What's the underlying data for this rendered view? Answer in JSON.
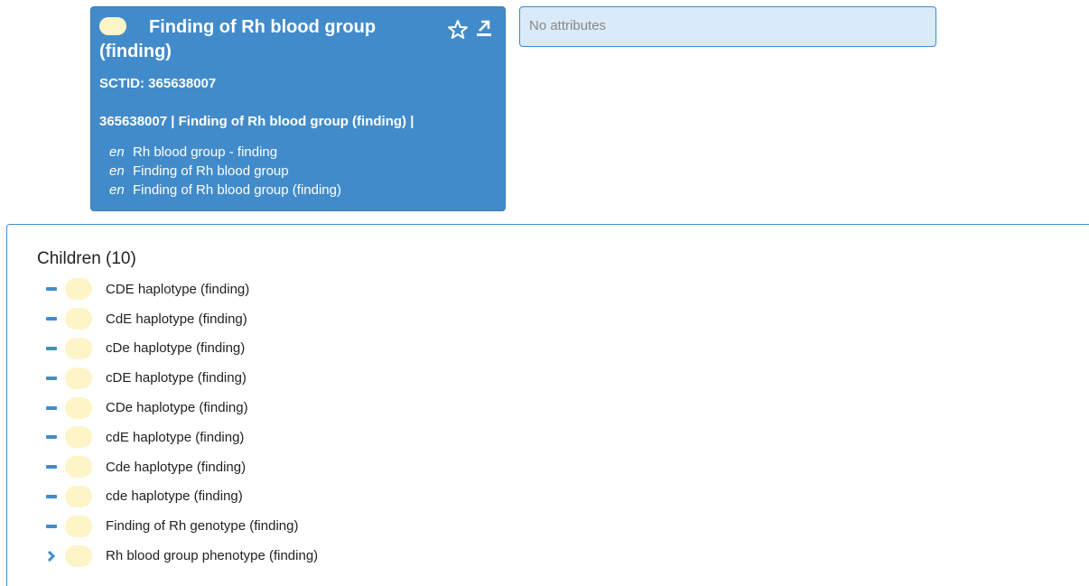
{
  "concept": {
    "title": "Finding of Rh blood group (finding)",
    "sctid_label": "SCTID: 365638007",
    "fsn_line": "365638007 | Finding of Rh blood group (finding) |",
    "descriptions": [
      {
        "lang": "en",
        "term": "Rh blood group - finding"
      },
      {
        "lang": "en",
        "term": "Finding of Rh blood group"
      },
      {
        "lang": "en",
        "term": "Finding of Rh blood group (finding)"
      }
    ],
    "icons": {
      "favorite": "star-outline-icon",
      "export": "export-icon"
    },
    "color": "#428bca",
    "badge_color": "#fdf4c8"
  },
  "attributes": {
    "text": "No attributes"
  },
  "children": {
    "heading": "Children (10)",
    "items": [
      {
        "label": "CDE haplotype (finding)",
        "toggle": "minus-icon"
      },
      {
        "label": "CdE haplotype (finding)",
        "toggle": "minus-icon"
      },
      {
        "label": "cDe haplotype (finding)",
        "toggle": "minus-icon"
      },
      {
        "label": "cDE haplotype (finding)",
        "toggle": "minus-icon"
      },
      {
        "label": "CDe haplotype (finding)",
        "toggle": "minus-icon"
      },
      {
        "label": "cdE haplotype (finding)",
        "toggle": "minus-icon"
      },
      {
        "label": "Cde haplotype (finding)",
        "toggle": "minus-icon"
      },
      {
        "label": "cde haplotype (finding)",
        "toggle": "minus-icon"
      },
      {
        "label": "Finding of Rh genotype (finding)",
        "toggle": "minus-icon"
      },
      {
        "label": "Rh blood group phenotype (finding)",
        "toggle": "chevron-right-icon"
      }
    ]
  }
}
